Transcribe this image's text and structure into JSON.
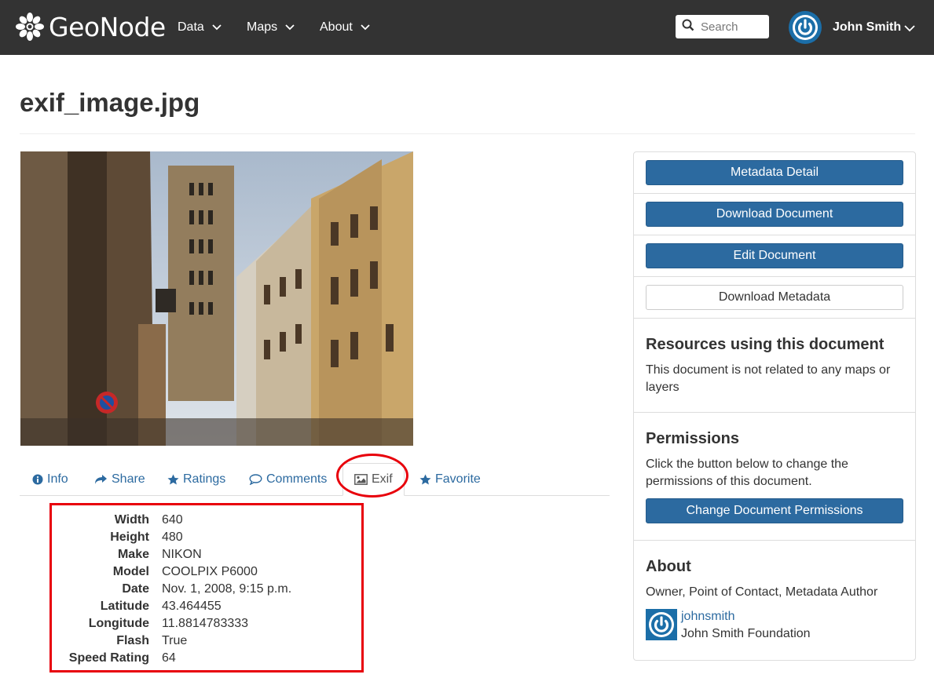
{
  "header": {
    "brand": "GeoNode",
    "nav": [
      {
        "label": "Data"
      },
      {
        "label": "Maps"
      },
      {
        "label": "About"
      }
    ],
    "search_placeholder": "Search",
    "user_name": "John Smith"
  },
  "page": {
    "title": "exif_image.jpg"
  },
  "tabs": [
    {
      "label": "Info",
      "icon": "info-circle-icon"
    },
    {
      "label": "Share",
      "icon": "share-arrow-icon"
    },
    {
      "label": "Ratings",
      "icon": "star-icon"
    },
    {
      "label": "Comments",
      "icon": "comment-icon"
    },
    {
      "label": "Exif",
      "icon": "image-icon",
      "active": true
    },
    {
      "label": "Favorite",
      "icon": "star-icon"
    }
  ],
  "exif": [
    {
      "key": "Width",
      "value": "640"
    },
    {
      "key": "Height",
      "value": "480"
    },
    {
      "key": "Make",
      "value": "NIKON"
    },
    {
      "key": "Model",
      "value": "COOLPIX P6000"
    },
    {
      "key": "Date",
      "value": "Nov. 1, 2008, 9:15 p.m."
    },
    {
      "key": "Latitude",
      "value": "43.464455"
    },
    {
      "key": "Longitude",
      "value": "11.8814783333"
    },
    {
      "key": "Flash",
      "value": "True"
    },
    {
      "key": "Speed Rating",
      "value": "64"
    }
  ],
  "sidebar": {
    "metadata_detail": "Metadata Detail",
    "download_document": "Download Document",
    "edit_document": "Edit Document",
    "download_metadata": "Download Metadata",
    "resources_heading": "Resources using this document",
    "resources_text": "This document is not related to any maps or layers",
    "permissions_heading": "Permissions",
    "permissions_text": "Click the button below to change the permissions of this document.",
    "change_permissions": "Change Document Permissions",
    "about_heading": "About",
    "about_roles": "Owner, Point of Contact, Metadata Author",
    "owner_username": "johnsmith",
    "owner_org": "John Smith Foundation"
  },
  "colors": {
    "navbar": "#333333",
    "primary": "#2c6aa0",
    "highlight": "#e8000b"
  }
}
